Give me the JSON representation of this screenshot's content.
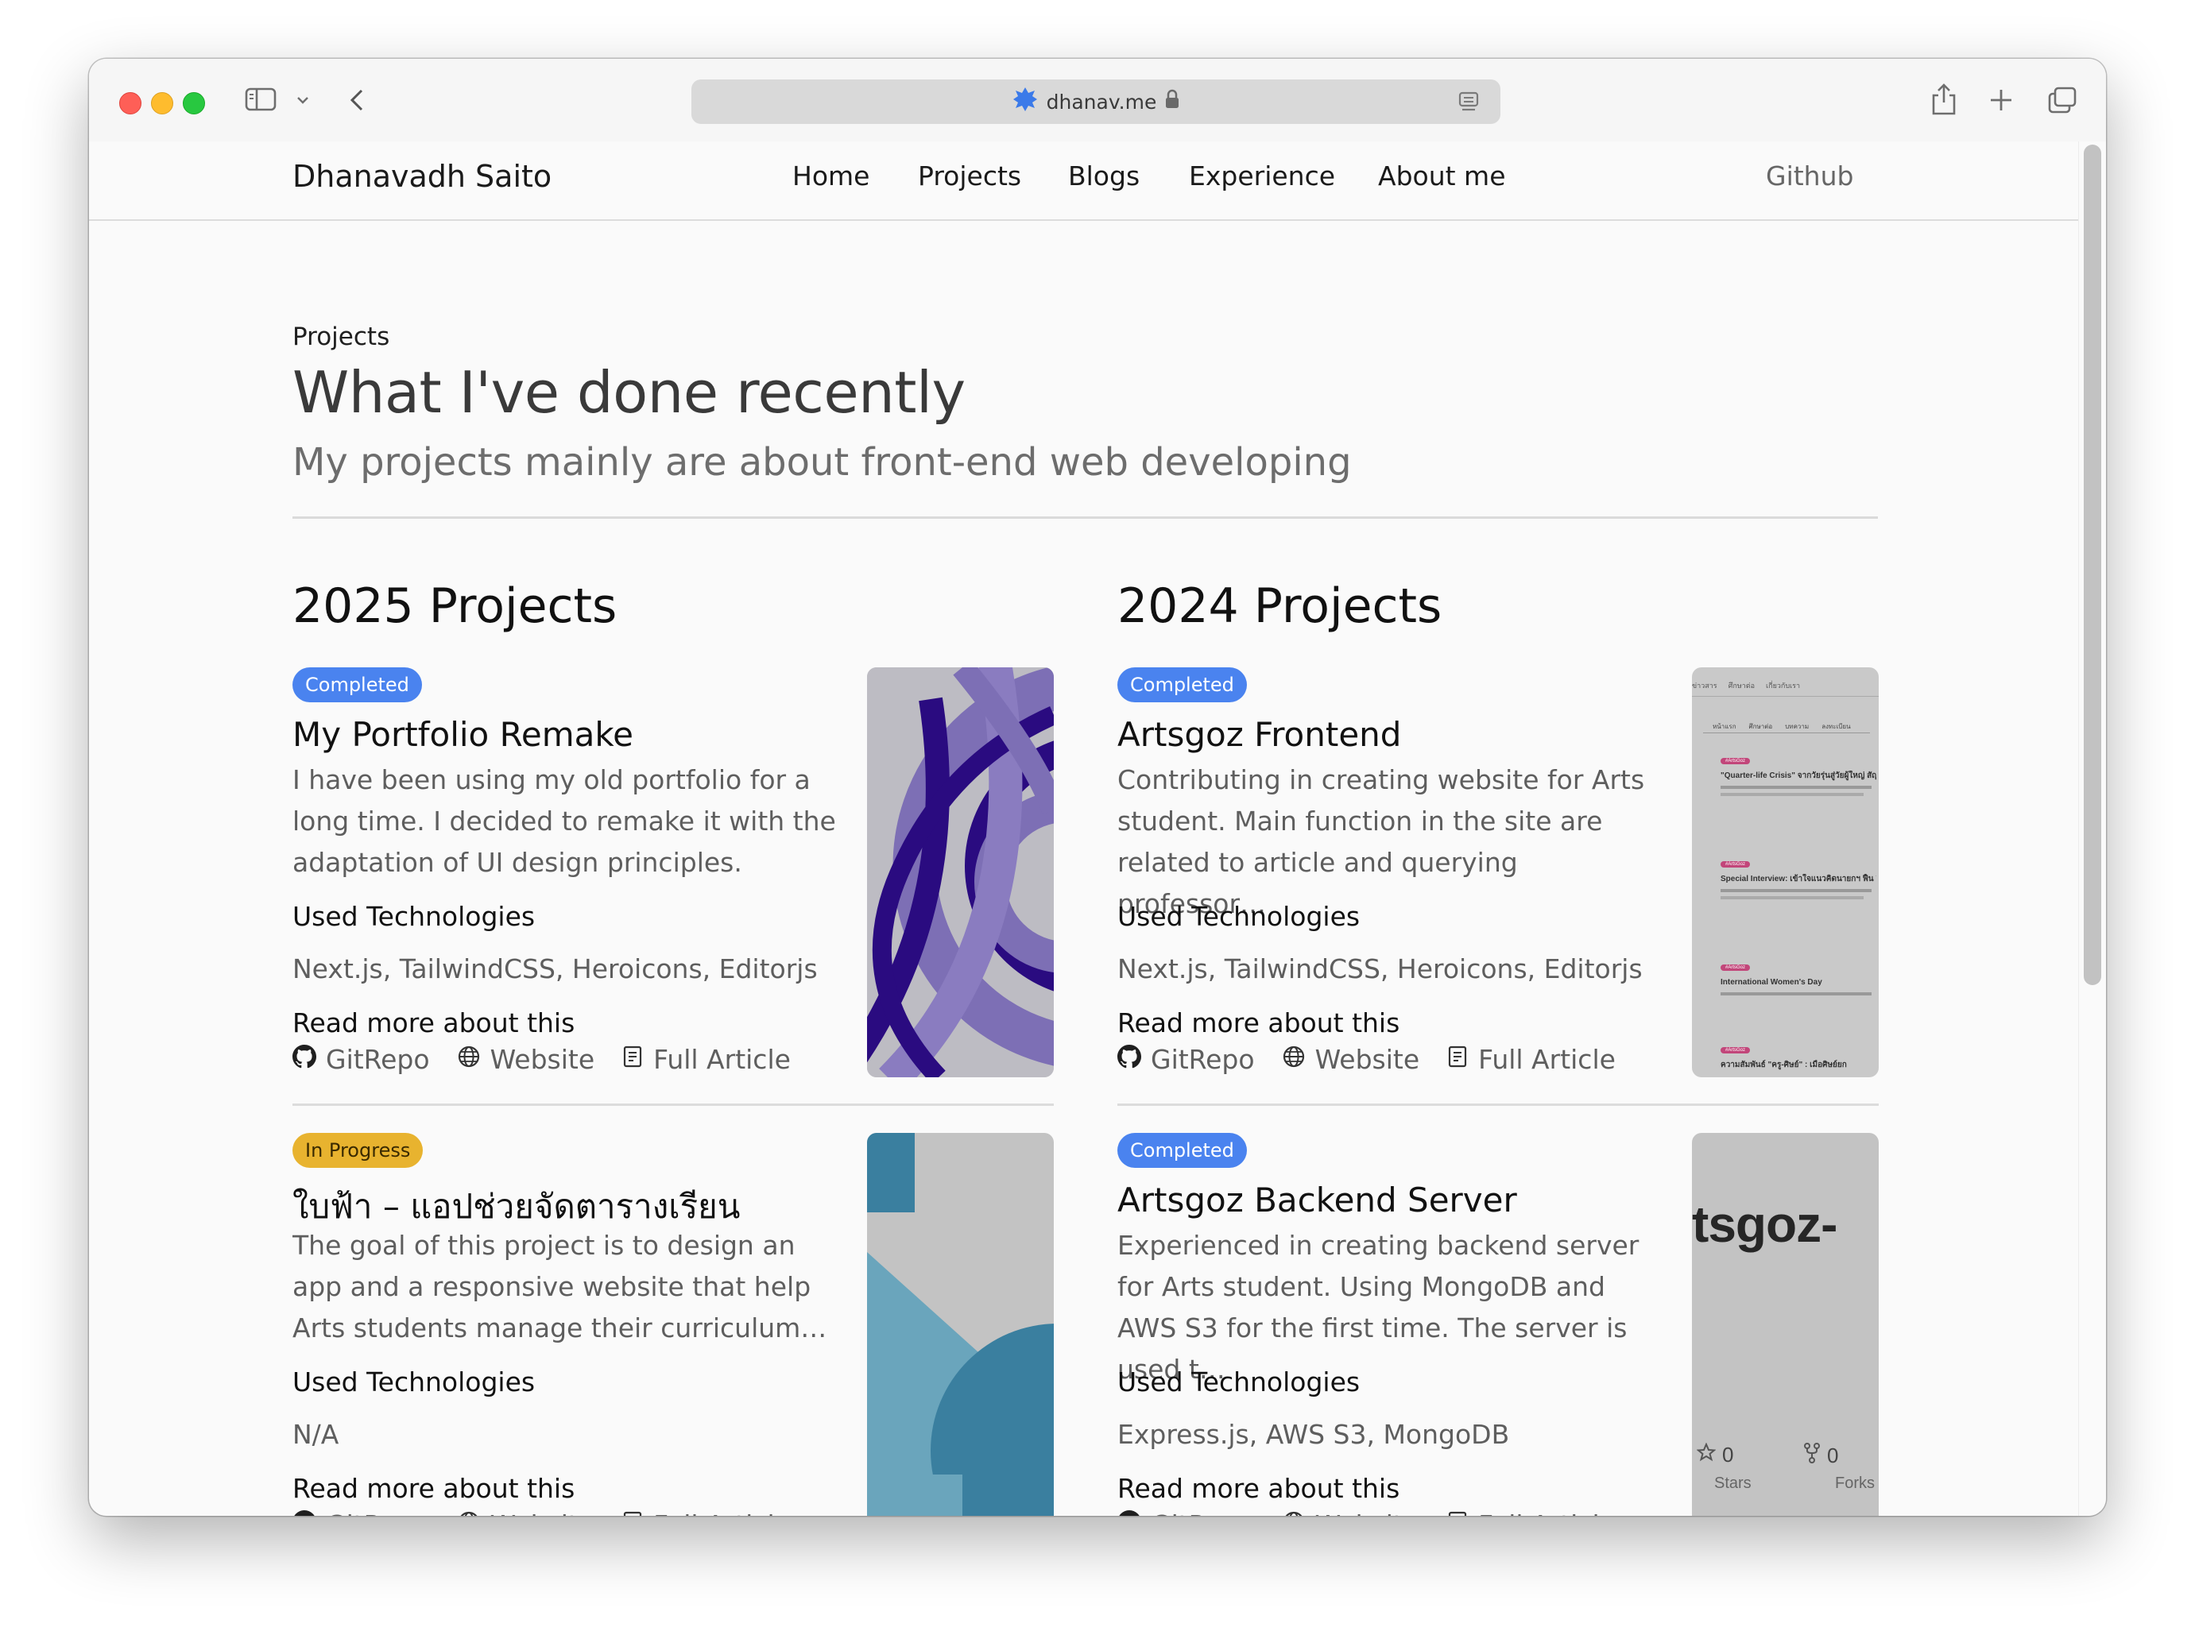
{
  "browser": {
    "url": "dhanav.me"
  },
  "nav": {
    "brand": "Dhanavadh Saito",
    "links": [
      "Home",
      "Projects",
      "Blogs",
      "Experience",
      "About me"
    ],
    "github": "Github"
  },
  "hero": {
    "eyebrow": "Projects",
    "title": "What I've done recently",
    "subtitle": "My projects mainly are about front-end web developing"
  },
  "columns": [
    {
      "heading": "2025 Projects",
      "cards": [
        {
          "status": "Completed",
          "title": "My Portfolio Remake",
          "description": "I have been using my old portfolio for a long time. I decided to remake it with the adaptation of UI design principles.",
          "tech_heading": "Used Technologies",
          "tech": "Next.js, TailwindCSS, Heroicons, Editorjs",
          "read_more": "Read more about this",
          "links": [
            "GitRepo",
            "Website",
            "Full Article"
          ]
        },
        {
          "status": "In Progress",
          "title": "ใบฟ้า – แอปช่วยจัดตารางเรียน",
          "description": "The goal of this project is to design an app and a responsive website that help Arts students manage their curriculum…",
          "tech_heading": "Used Technologies",
          "tech": "N/A",
          "read_more": "Read more about this",
          "links": [
            "GitRepo",
            "Website",
            "Full Article"
          ]
        }
      ]
    },
    {
      "heading": "2024 Projects",
      "cards": [
        {
          "status": "Completed",
          "title": "Artsgoz Frontend",
          "description": "Contributing in creating website for Arts student. Main function in the site are related to article and querying professor…",
          "tech_heading": "Used Technologies",
          "tech": "Next.js, TailwindCSS, Heroicons, Editorjs",
          "read_more": "Read more about this",
          "links": [
            "GitRepo",
            "Website",
            "Full Article"
          ]
        },
        {
          "status": "Completed",
          "title": "Artsgoz Backend Server",
          "description": "Experienced in creating backend server for Arts student. Using MongoDB and AWS S3 for the first time. The server is used t…",
          "tech_heading": "Used Technologies",
          "tech": "Express.js, AWS S3, MongoDB",
          "read_more": "Read more about this",
          "links": [
            "GitRepo",
            "Website",
            "Full Article"
          ]
        }
      ]
    }
  ],
  "thumbs": {
    "backend": {
      "repo_text": "tsgoz-",
      "stars_count": "0",
      "stars_label": "Stars",
      "forks_count": "0",
      "forks_label": "Forks"
    },
    "frontend": {
      "nav": [
        "ข่าวสาร",
        "ศึกษาต่อ",
        "เกี่ยวกับเรา"
      ],
      "tabs": [
        "หน้าแรก",
        "ศึกษาต่อ",
        "บทความ",
        "ลงทะเบียน"
      ],
      "posts": [
        {
          "tag": "#ArtsGoz",
          "title": "\"Quarter-life Crisis\" จากวัยรุ่นสู่วัยผู้ใหญ่ สัญญาณเตือน"
        },
        {
          "tag": "#ArtsGoz",
          "title": "Special Interview: เข้าใจแนวคิดนายกฯ ฟื้น อิศรางกูร ณ อยุธยา"
        },
        {
          "tag": "#ArtsGoz",
          "title": "International Women's Day"
        },
        {
          "tag": "#ArtsGoz",
          "title": "ความสัมพันธ์ \"ครู-ศิษย์\" : เมื่อศิษย์ยก"
        }
      ]
    }
  },
  "colors": {
    "badge_completed": "#4a83ef",
    "badge_in_progress": "#e8b32f"
  }
}
